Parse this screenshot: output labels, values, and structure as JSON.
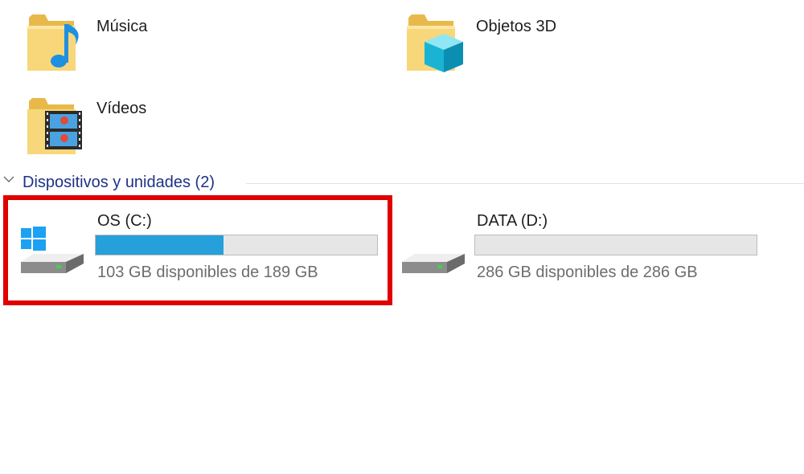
{
  "folders": [
    {
      "label": "Música",
      "icon": "music-folder-icon"
    },
    {
      "label": "Objetos 3D",
      "icon": "3d-objects-folder-icon"
    },
    {
      "label": "Vídeos",
      "icon": "videos-folder-icon"
    }
  ],
  "devices_group": {
    "title": "Dispositivos y unidades (2)"
  },
  "drives": [
    {
      "name": "OS (C:)",
      "free_text": "103 GB disponibles de 189 GB",
      "used_fraction": 0.455,
      "icon": "windows-drive-icon"
    },
    {
      "name": "DATA (D:)",
      "free_text": "286 GB disponibles de 286 GB",
      "used_fraction": 0.0,
      "icon": "hard-drive-icon"
    }
  ],
  "colors": {
    "accent": "#26a0da",
    "group_title": "#1e3287",
    "highlight": "#e00000"
  }
}
